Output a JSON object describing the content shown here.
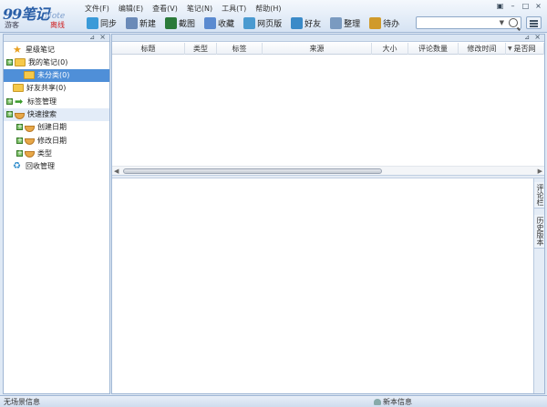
{
  "app": {
    "logo_text": "99笔记",
    "logo_sub": "Note",
    "user_label": "游客",
    "offline_label": "离线"
  },
  "menu": [
    "文件(F)",
    "编辑(E)",
    "查看(V)",
    "笔记(N)",
    "工具(T)",
    "帮助(H)"
  ],
  "toolbar": [
    {
      "label": "同步",
      "icon": "sync-icon",
      "color": "#3a9ad8"
    },
    {
      "label": "新建",
      "icon": "new-note-icon",
      "color": "#6a8ab8"
    },
    {
      "label": "截图",
      "icon": "screenshot-icon",
      "color": "#2a7a3a"
    },
    {
      "label": "收藏",
      "icon": "favorite-icon",
      "color": "#5a8ad0"
    },
    {
      "label": "网页版",
      "icon": "web-version-icon",
      "color": "#4a9ad0"
    },
    {
      "label": "好友",
      "icon": "friends-icon",
      "color": "#3a8ac8"
    },
    {
      "label": "整理",
      "icon": "organize-icon",
      "color": "#7a9ac0"
    },
    {
      "label": "待办",
      "icon": "todo-icon",
      "color": "#d09a2a"
    }
  ],
  "search": {
    "placeholder": ""
  },
  "tree": [
    {
      "label": "星级笔记",
      "icon": "star-icon",
      "expander": false,
      "indent": 0
    },
    {
      "label": "我的笔记(0)",
      "icon": "folder-icon",
      "expander": true,
      "indent": 0
    },
    {
      "label": "未分类(0)",
      "icon": "folder-icon",
      "expander": false,
      "indent": 1,
      "selected": true
    },
    {
      "label": "好友共享(0)",
      "icon": "shared-folder-icon",
      "expander": false,
      "indent": 0
    },
    {
      "label": "标签管理",
      "icon": "tag-arrow-icon",
      "expander": true,
      "indent": 0
    },
    {
      "label": "快速搜索",
      "icon": "quick-search-icon",
      "expander": true,
      "indent": 0,
      "highlight": true
    },
    {
      "label": "创建日期",
      "icon": "date-icon",
      "expander": true,
      "indent": 1
    },
    {
      "label": "修改日期",
      "icon": "date-icon",
      "expander": true,
      "indent": 1
    },
    {
      "label": "类型",
      "icon": "type-icon",
      "expander": true,
      "indent": 1
    },
    {
      "label": "回收管理",
      "icon": "recycle-icon",
      "expander": false,
      "indent": 0
    }
  ],
  "columns": [
    "标题",
    "类型",
    "标签",
    "来源",
    "大小",
    "评论数量",
    "修改时间",
    "是否网"
  ],
  "side_tabs": [
    "评论栏",
    "历史版本"
  ],
  "status": {
    "message": "无场景信息",
    "news": "新本信息"
  }
}
